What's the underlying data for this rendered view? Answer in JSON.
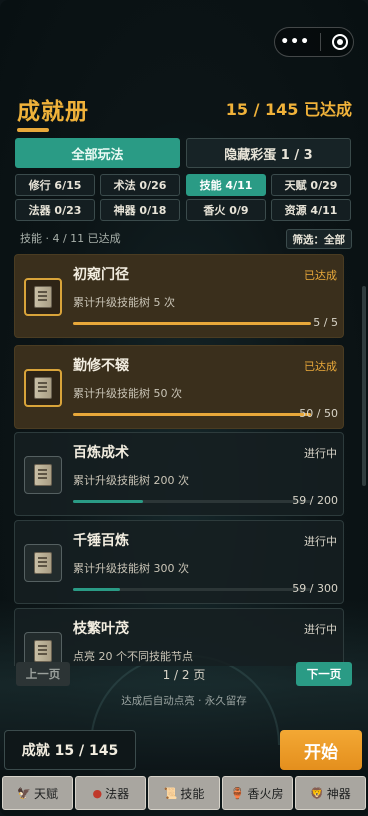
{
  "header": {
    "title": "成就册",
    "total": "15 / 145 已达成"
  },
  "top_tabs": [
    {
      "label": "全部玩法",
      "active": true
    },
    {
      "label": "隐藏彩蛋 1 / 3",
      "active": false
    }
  ],
  "categories": [
    {
      "label": "修行 6/15",
      "active": false
    },
    {
      "label": "术法 0/26",
      "active": false
    },
    {
      "label": "技能 4/11",
      "active": true
    },
    {
      "label": "天赋 0/29",
      "active": false
    },
    {
      "label": "法器 0/23",
      "active": false
    },
    {
      "label": "神器 0/18",
      "active": false
    },
    {
      "label": "香火 0/9",
      "active": false
    },
    {
      "label": "资源 4/11",
      "active": false
    }
  ],
  "subline": "技能 · 4 / 11 已达成",
  "filter_label": "筛选：全部",
  "achievements": [
    {
      "name": "初窥门径",
      "desc": "累计升级技能树 5 次",
      "status": "已达成",
      "count": "5 / 5",
      "progress": 1.0,
      "done": true
    },
    {
      "name": "勤修不辍",
      "desc": "累计升级技能树 50 次",
      "status": "已达成",
      "count": "50 / 50",
      "progress": 1.0,
      "done": true
    },
    {
      "name": "百炼成术",
      "desc": "累计升级技能树 200 次",
      "status": "进行中",
      "count": "59 / 200",
      "progress": 0.295,
      "done": false
    },
    {
      "name": "千锤百炼",
      "desc": "累计升级技能树 300 次",
      "status": "进行中",
      "count": "59 / 300",
      "progress": 0.197,
      "done": false
    },
    {
      "name": "枝繁叶茂",
      "desc": "点亮 20 个不同技能节点",
      "status": "进行中",
      "count": "",
      "progress": 0,
      "done": false
    }
  ],
  "pager": {
    "prev": "上一页",
    "label": "1 / 2 页",
    "next": "下一页"
  },
  "hint": "达成后自动点亮 · 永久留存",
  "footer": {
    "achievement_count": "成就 15 / 145",
    "start_label": "开始"
  },
  "tabbar": [
    {
      "label": "天赋",
      "icon": "talent-icon"
    },
    {
      "label": "法器",
      "icon": "artifact-icon"
    },
    {
      "label": "技能",
      "icon": "skill-icon"
    },
    {
      "label": "香火房",
      "icon": "incense-icon"
    },
    {
      "label": "神器",
      "icon": "relic-icon"
    }
  ],
  "colors": {
    "accent_gold": "#f0b23a",
    "accent_teal": "#2a9b85",
    "start_orange": "#f3a834"
  }
}
